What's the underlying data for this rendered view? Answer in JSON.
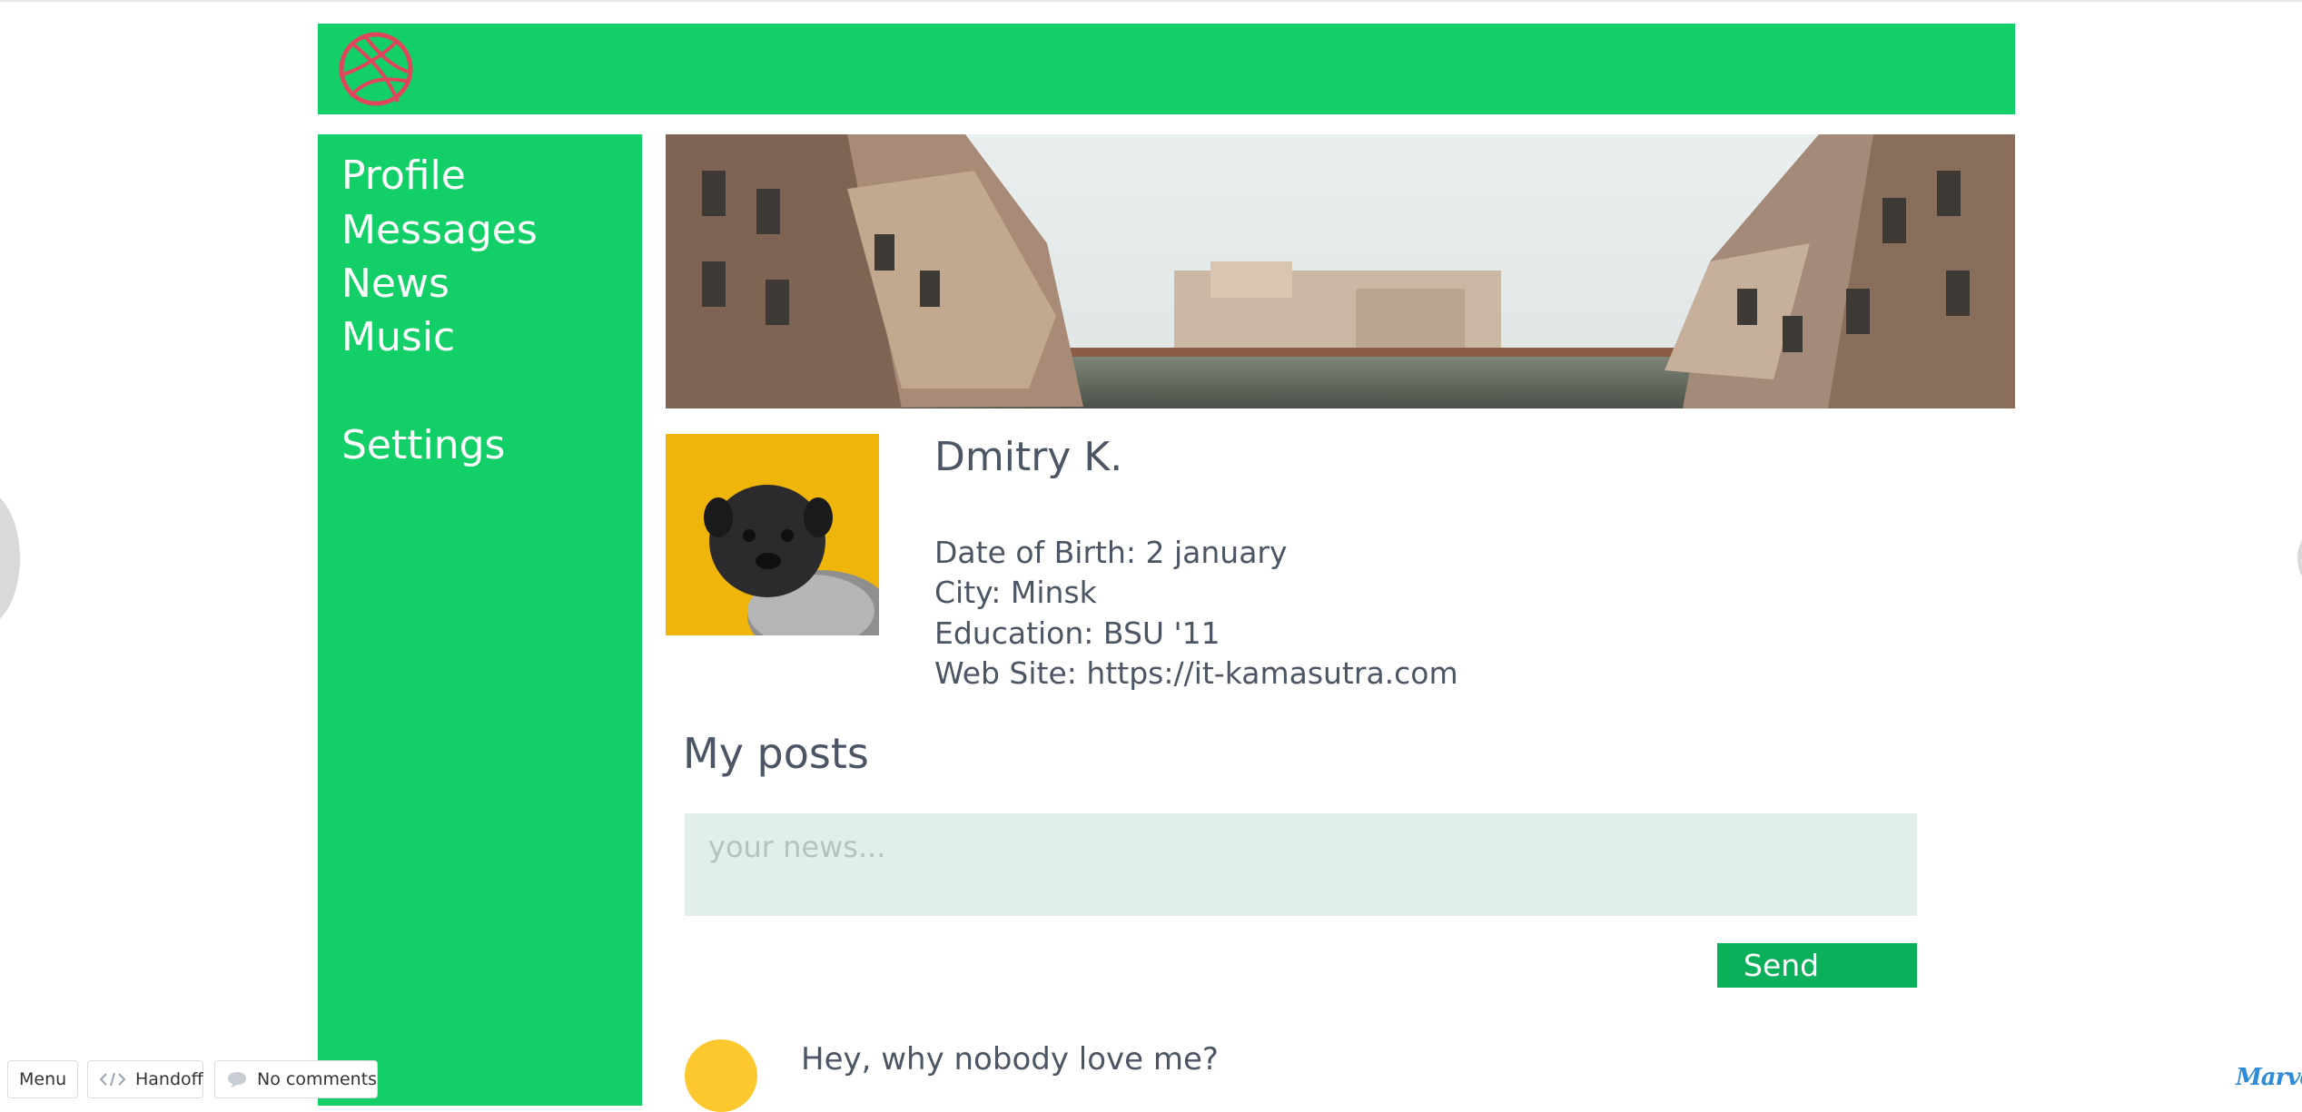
{
  "header": {
    "logo_icon": "dribbble-ball-icon",
    "logo_color": "#e0455d",
    "background": "#13cf68"
  },
  "sidebar": {
    "background": "#13cf68",
    "items": [
      {
        "label": "Profile",
        "icon": "none"
      },
      {
        "label": "Messages",
        "icon": "none"
      },
      {
        "label": "News",
        "icon": "none"
      },
      {
        "label": "Music",
        "icon": "none"
      },
      {
        "label": "Settings",
        "icon": "none"
      }
    ]
  },
  "profile": {
    "name": "Dmitry K.",
    "date_of_birth": "Date of Birth: 2 january",
    "city": "City: Minsk",
    "education": "Education: BSU '11",
    "website": "Web Site: https://it-kamasutra.com"
  },
  "posts": {
    "title": "My posts",
    "input_placeholder": "your news...",
    "input_value": "",
    "send_label": "Send",
    "items": [
      {
        "text": "Hey, why nobody love me?"
      }
    ]
  },
  "toolbar": {
    "menu_label": "Menu",
    "handoff_label": "Handoff",
    "comments_label": "No comments"
  },
  "branding": {
    "marvel_label": "Marvel"
  },
  "colors": {
    "accent_green": "#13cf68",
    "send_green": "#0db05a",
    "text": "#4b5563",
    "avatar_bg": "#efb50b",
    "post_avatar": "#fdc82d"
  }
}
